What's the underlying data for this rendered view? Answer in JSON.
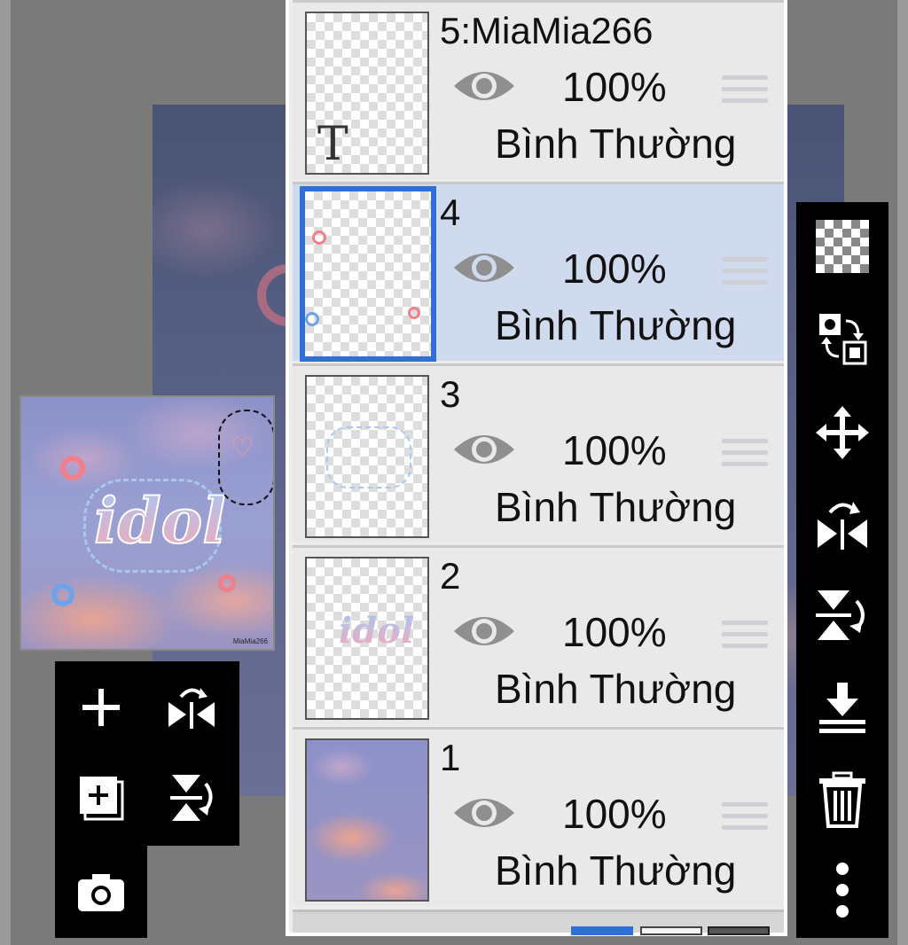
{
  "layers": [
    {
      "name": "5:MiaMia266",
      "opacity": "100%",
      "blend": "Bình Thường",
      "selected": false
    },
    {
      "name": "4",
      "opacity": "100%",
      "blend": "Bình Thường",
      "selected": true
    },
    {
      "name": "3",
      "opacity": "100%",
      "blend": "Bình Thường",
      "selected": false
    },
    {
      "name": "2",
      "opacity": "100%",
      "blend": "Bình Thường",
      "selected": false
    },
    {
      "name": "1",
      "opacity": "100%",
      "blend": "Bình Thường",
      "selected": false
    }
  ],
  "thumb_text_layer_glyph": "T",
  "thumb_idol_text": "idol",
  "preview": {
    "main_text": "idol",
    "signature": "MiaMia266"
  },
  "icons": {
    "left_tools": [
      "add-layer-icon",
      "flip-horizontal-icon",
      "add-image-layer-icon",
      "flip-vertical-icon",
      "camera-icon"
    ],
    "right_tools": [
      "transparency-icon",
      "swap-icon",
      "move-icon",
      "flip-horizontal-icon",
      "flip-vertical-icon",
      "merge-down-icon",
      "delete-icon",
      "more-icon"
    ]
  },
  "colors": {
    "selection": "#2f6fd6",
    "selected_row": "#cfdaef",
    "panel": "#e9e9e9"
  }
}
